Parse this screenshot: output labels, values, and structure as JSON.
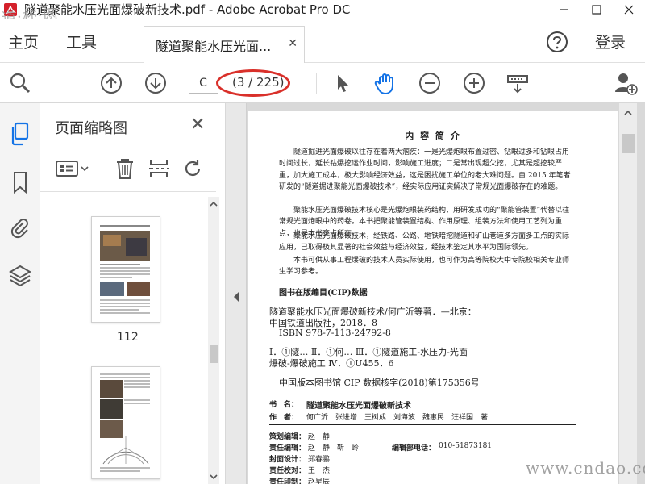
{
  "window": {
    "title": "隧道聚能水压光面爆破新技术.pdf - Adobe Acrobat Pro DC"
  },
  "nav": {
    "home": "主页",
    "tools": "工具",
    "doc_tab": "隧道聚能水压光面...",
    "login": "登录"
  },
  "toolbar": {
    "page_input": "C",
    "page_count": "(3 / 225)"
  },
  "thumbnails": {
    "title": "页面缩略图",
    "pages": [
      {
        "label": "112"
      }
    ]
  },
  "document": {
    "heading": "内 容 简 介",
    "paragraphs": [
      "隧道掘进光面爆破以往存在着两大痼疾：一是光爆炮眼布置过密、钻眼过多和钻眼占用时间过长，延长钻爆挖运作业时间，影响施工进度；二是常出现超欠挖，尤其是超挖较严重，加大施工成本，极大影响经济效益，这是困扰施工单位的老大难问题。自 2015 年笔者研发的“隧道掘进聚能光面爆破技术”，经实际应用证实解决了常规光面爆破存在的难题。",
      "聚能水压光面爆破技术核心是光爆炮眼装药结构，用研发成功的“聚能管装置”代替以往常规光面炮眼中的药卷。本书把聚能管装置结构、作用原理、组装方法和使用工艺列为重点，也是本书亮点所在。",
      "聚能水压光面爆破技术，经铁路、公路、地铁暗挖隧道和矿山巷道多方面多工点的实际应用，已取得极其显著的社会效益与经济效益，经技术鉴定其水平为国际领先。",
      "本书可供从事工程爆破的技术人员实际使用，也可作为高等院校大中专院校相关专业师生学习参考。"
    ],
    "cip_title": "图书在版编目(CIP)数据",
    "cip_lines": [
      "隧道聚能水压光面爆破新技术/何广沂等著．—北京：",
      "中国铁道出版社，2018．8",
      "ISBN 978-7-113-24792-8",
      "Ⅰ．①隧…  Ⅱ．①何…  Ⅲ．①隧道施工-水压力-光面",
      "爆破-爆破施工  Ⅳ．①U455．6",
      "中国版本图书馆 CIP 数据核字(2018)第175356号"
    ],
    "book_name_label": "书　名：",
    "book_name": "隧道聚能水压光面爆破新技术",
    "authors_label": "作　者：",
    "authors": "何广沂　张进增　王树成　刘海波　魏惠民　汪祥国　著",
    "credits": [
      {
        "label": "策划编辑：",
        "value": "赵　静"
      },
      {
        "label": "责任编辑：",
        "value": "赵　静　靳　岭"
      },
      {
        "label": "封面设计：",
        "value": "郑春鹏"
      },
      {
        "label": "责任校对：",
        "value": "王　杰"
      },
      {
        "label": "责任印制：",
        "value": "赵星辰"
      }
    ],
    "phone_label": "编辑部电话：",
    "phone": "010-51873181"
  },
  "watermarks": {
    "top_left": "道·杯·网",
    "bottom_right": "www.cndao.com"
  },
  "colors": {
    "accent_blue": "#1473e6",
    "annotation_red": "#d9302a"
  },
  "icons": {
    "app": "acrobat-pdf-icon",
    "zoom": "magnifier-icon",
    "prev": "arrow-up-circle-icon",
    "next": "arrow-down-circle-icon",
    "select": "pointer-arrow-icon",
    "hand": "hand-icon",
    "zoom_out": "minus-circle-icon",
    "zoom_in": "plus-circle-icon",
    "fit": "fit-page-icon",
    "add_user": "add-user-icon"
  }
}
